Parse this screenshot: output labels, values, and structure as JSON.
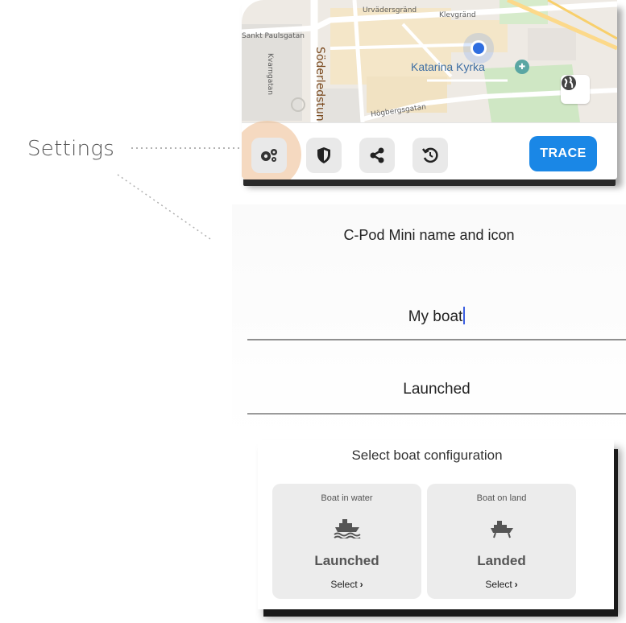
{
  "callout": {
    "label": "Settings"
  },
  "map": {
    "streets": {
      "urvadersgrand": "Urvädersgränd",
      "klevgrand": "Klevgränd",
      "sankt_paulsgatan": "Sankt Paulsgatan",
      "kvarngatan": "Kvarngatan",
      "soderledstunneln": "Söderledstun",
      "hogbergsgatan": "Högbergsgatan"
    },
    "poi_label": "Katarina Kyrka",
    "globe_icon": "globe-icon"
  },
  "toolbar": {
    "buttons": [
      {
        "icon": "gears-icon",
        "name": "settings"
      },
      {
        "icon": "shield-icon",
        "name": "privacy"
      },
      {
        "icon": "share-icon",
        "name": "share"
      },
      {
        "icon": "history-icon",
        "name": "history"
      }
    ],
    "trace_label": "TRACE",
    "colors": {
      "accent": "#1a87e6",
      "halo": "#ecba8c"
    }
  },
  "name_panel": {
    "title": "C-Pod Mini name and icon",
    "name_value": "My boat",
    "status_value": "Launched"
  },
  "config": {
    "title": "Select boat configuration",
    "options": [
      {
        "caption": "Boat in water",
        "icon": "boat-in-water-icon",
        "state": "Launched",
        "select": "Select"
      },
      {
        "caption": "Boat on land",
        "icon": "boat-on-land-icon",
        "state": "Landed",
        "select": "Select"
      }
    ]
  }
}
